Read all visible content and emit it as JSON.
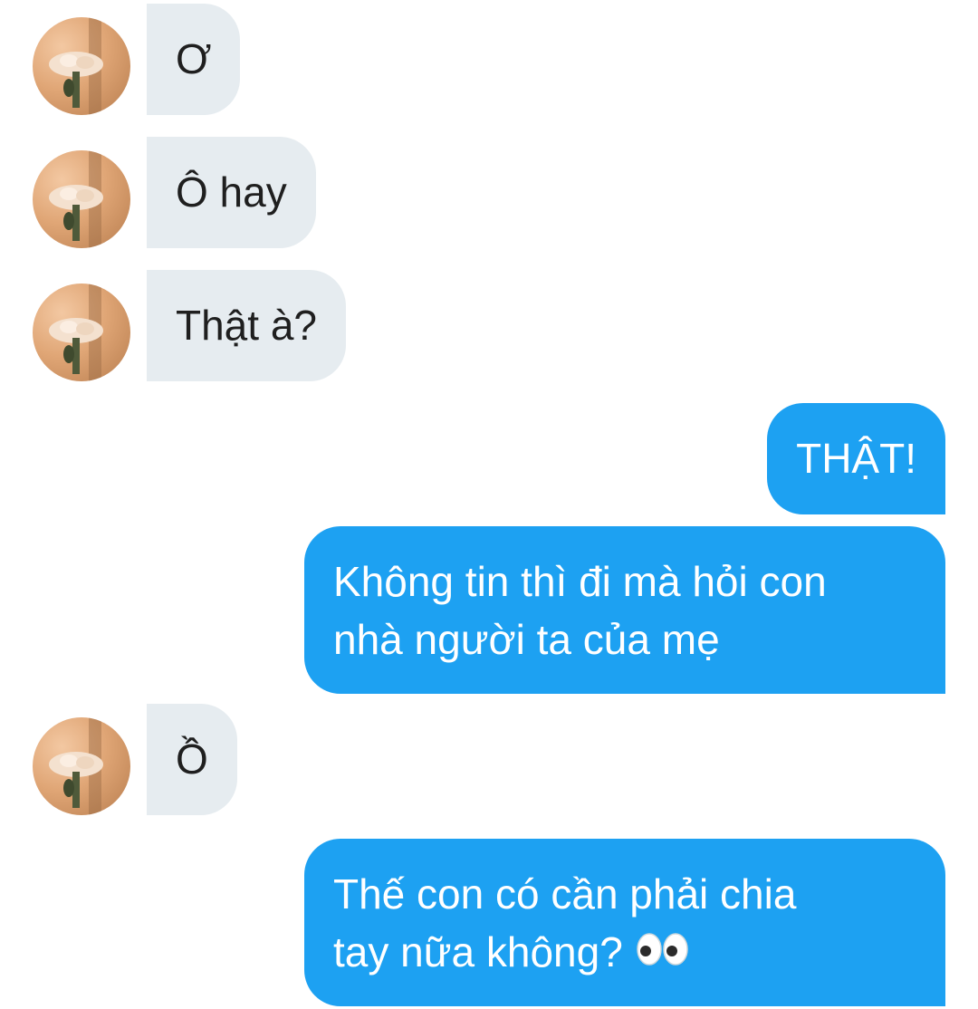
{
  "messages": [
    {
      "side": "in",
      "text": "Ơ"
    },
    {
      "side": "in",
      "text": "Ô hay"
    },
    {
      "side": "in",
      "text": "Thật à?"
    },
    {
      "side": "out",
      "text": "THẬT!"
    },
    {
      "side": "out",
      "lines": [
        "Không tin thì đi mà hỏi con",
        "nhà người ta của mẹ"
      ]
    },
    {
      "side": "in",
      "text": "Ồ"
    },
    {
      "side": "out",
      "lines": [
        "Thế con có cần phải chia",
        "tay nữa không?"
      ],
      "trailing_icon": "eyes-emoji-icon"
    }
  ],
  "colors": {
    "incoming_bubble": "#e6ecf0",
    "outgoing_bubble": "#1da1f2",
    "incoming_text": "#1f1f1f",
    "outgoing_text": "#ffffff"
  }
}
